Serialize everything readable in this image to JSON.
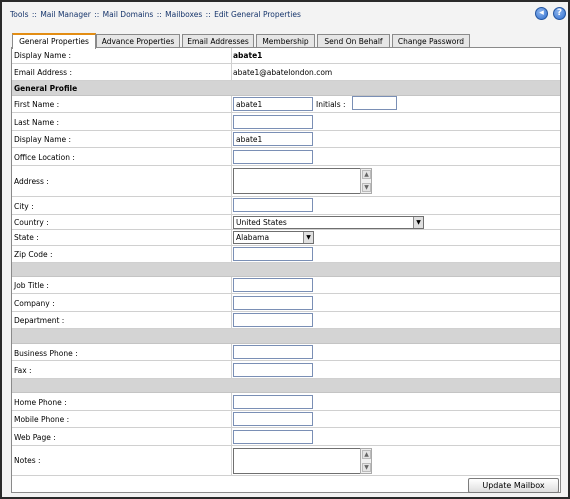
{
  "breadcrumb": {
    "items": [
      "Tools",
      "Mail Manager",
      "Mail Domains",
      "Mailboxes",
      "Edit General Properties"
    ],
    "separator": "::"
  },
  "header": {
    "back_icon": "back-arrow-icon",
    "help_icon": "help-icon",
    "back_glyph": "◂",
    "help_glyph": "?"
  },
  "tabs": [
    {
      "label": "General Properties",
      "active": true
    },
    {
      "label": "Advance Properties",
      "active": false
    },
    {
      "label": "Email Addresses",
      "active": false
    },
    {
      "label": "Membership",
      "active": false
    },
    {
      "label": "Send On Behalf",
      "active": false
    },
    {
      "label": "Change Password",
      "active": false
    }
  ],
  "form": {
    "display_name": {
      "label": "Display Name :",
      "value": "abate1"
    },
    "email_address": {
      "label": "Email Address :",
      "value": "abate1@abatelondon.com"
    },
    "general_profile": "General Profile",
    "first_name": {
      "label": "First Name :",
      "value": "abate1"
    },
    "initials": {
      "label": "Initials :",
      "value": ""
    },
    "last_name": {
      "label": "Last Name :",
      "value": ""
    },
    "display_name_field": {
      "label": "Display Name :",
      "value": "abate1"
    },
    "office_location": {
      "label": "Office Location :",
      "value": ""
    },
    "address": {
      "label": "Address :",
      "value": ""
    },
    "city": {
      "label": "City :",
      "value": ""
    },
    "country": {
      "label": "Country :",
      "value": "United States"
    },
    "state": {
      "label": "State :",
      "value": "Alabama"
    },
    "zip_code": {
      "label": "Zip Code :",
      "value": ""
    },
    "job_title": {
      "label": "Job Title :",
      "value": ""
    },
    "company": {
      "label": "Company :",
      "value": ""
    },
    "department": {
      "label": "Department :",
      "value": ""
    },
    "business_phone": {
      "label": "Business Phone :",
      "value": ""
    },
    "fax": {
      "label": "Fax :",
      "value": ""
    },
    "home_phone": {
      "label": "Home Phone :",
      "value": ""
    },
    "mobile_phone": {
      "label": "Mobile Phone :",
      "value": ""
    },
    "web_page": {
      "label": "Web Page :",
      "value": ""
    },
    "notes": {
      "label": "Notes :",
      "value": ""
    }
  },
  "update_button": "Update Mailbox",
  "colors": {
    "active_tab_accent": "#e38d13",
    "breadcrumb_text": "#15346b",
    "section_bg": "#d4d4d4"
  }
}
